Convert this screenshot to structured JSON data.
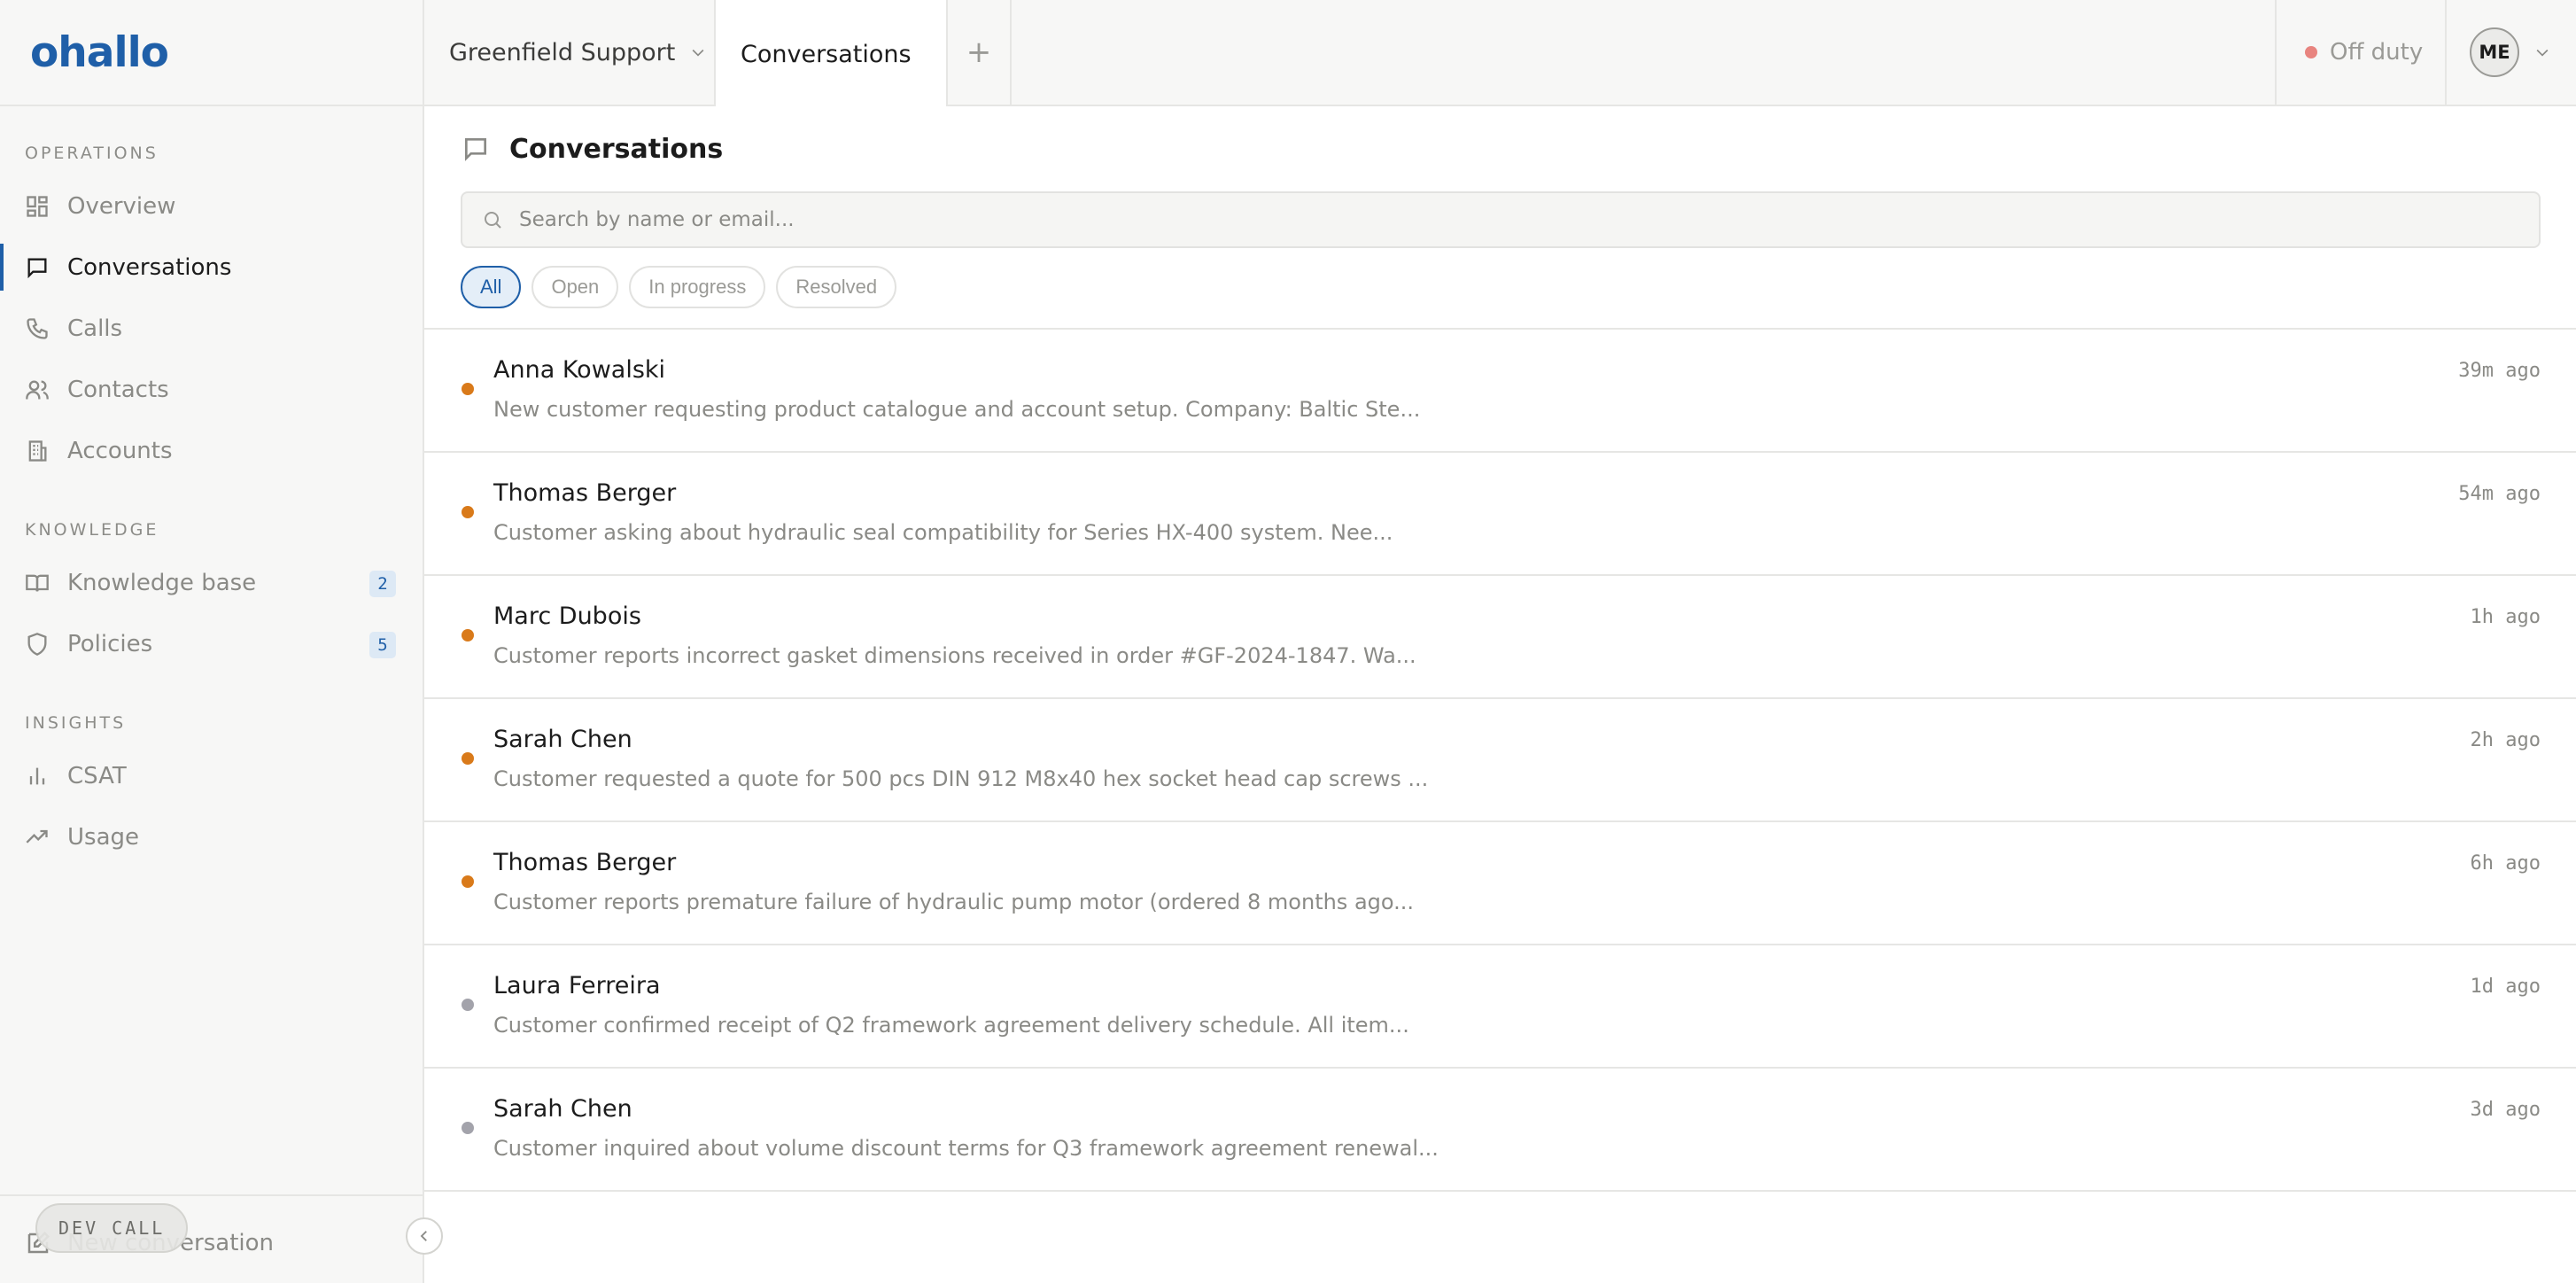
{
  "app": {
    "logo_text": "ohallo",
    "brand_color": "#1f5fa8"
  },
  "topbar": {
    "workspace": "Greenfield Support",
    "active_tab": "Conversations",
    "add_tab": "+",
    "status_label": "Off duty",
    "status_color": "#e8847f",
    "user_initials": "ME"
  },
  "sidebar": {
    "sections": [
      {
        "label": "OPERATIONS",
        "items": [
          {
            "label": "Overview",
            "icon": "grid-icon",
            "active": false
          },
          {
            "label": "Conversations",
            "icon": "chat-bubble-icon",
            "active": true
          },
          {
            "label": "Calls",
            "icon": "phone-icon",
            "active": false
          },
          {
            "label": "Contacts",
            "icon": "users-icon",
            "active": false
          },
          {
            "label": "Accounts",
            "icon": "building-icon",
            "active": false
          }
        ]
      },
      {
        "label": "KNOWLEDGE",
        "items": [
          {
            "label": "Knowledge base",
            "icon": "book-icon",
            "badge": "2"
          },
          {
            "label": "Policies",
            "icon": "shield-icon",
            "badge": "5"
          }
        ]
      },
      {
        "label": "INSIGHTS",
        "items": [
          {
            "label": "CSAT",
            "icon": "bar-chart-icon"
          },
          {
            "label": "Usage",
            "icon": "trend-up-icon"
          }
        ]
      }
    ],
    "footer": {
      "new_conversation": "New conversation",
      "dev_call": "DEV CALL"
    }
  },
  "main": {
    "title": "Conversations",
    "search_placeholder": "Search by name or email...",
    "filters": [
      {
        "label": "All",
        "active": true
      },
      {
        "label": "Open",
        "active": false
      },
      {
        "label": "In progress",
        "active": false
      },
      {
        "label": "Resolved",
        "active": false
      }
    ],
    "conversations": [
      {
        "name": "Anna Kowalski",
        "preview": "New customer requesting product catalogue and account setup. Company: Baltic Ste...",
        "time": "39m ago",
        "status_color": "#d97a1a"
      },
      {
        "name": "Thomas Berger",
        "preview": "Customer asking about hydraulic seal compatibility for Series HX-400 system. Nee...",
        "time": "54m ago",
        "status_color": "#d97a1a"
      },
      {
        "name": "Marc Dubois",
        "preview": "Customer reports incorrect gasket dimensions received in order #GF-2024-1847. Wa...",
        "time": "1h ago",
        "status_color": "#d97a1a"
      },
      {
        "name": "Sarah Chen",
        "preview": "Customer requested a quote for 500 pcs DIN 912 M8x40 hex socket head cap screws ...",
        "time": "2h ago",
        "status_color": "#d97a1a"
      },
      {
        "name": "Thomas Berger",
        "preview": "Customer reports premature failure of hydraulic pump motor (ordered 8 months ago...",
        "time": "6h ago",
        "status_color": "#d97a1a"
      },
      {
        "name": "Laura Ferreira",
        "preview": "Customer confirmed receipt of Q2 framework agreement delivery schedule. All item...",
        "time": "1d ago",
        "status_color": "#a3a3ab"
      },
      {
        "name": "Sarah Chen",
        "preview": "Customer inquired about volume discount terms for Q3 framework agreement renewal...",
        "time": "3d ago",
        "status_color": "#a3a3ab"
      }
    ]
  }
}
